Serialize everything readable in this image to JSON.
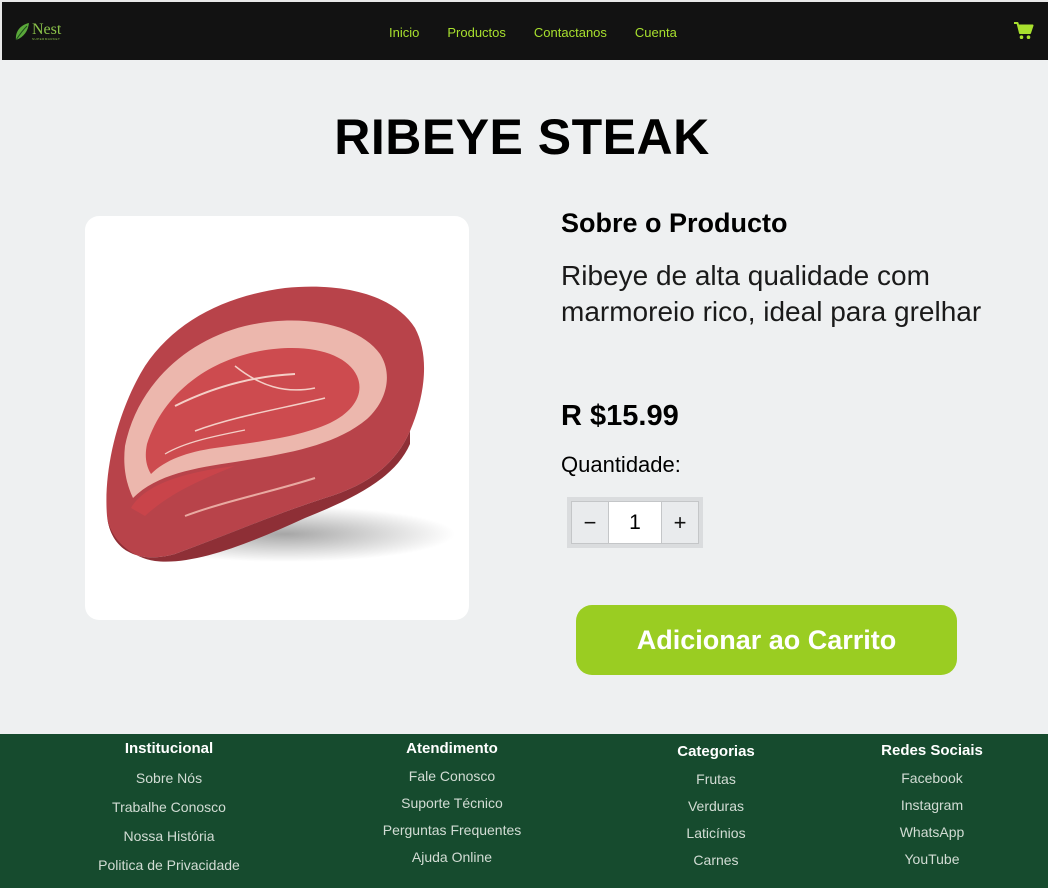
{
  "nav": {
    "logo_name": "Nest",
    "logo_sub": "SUPERMARKET",
    "links": [
      "Inicio",
      "Productos",
      "Contactanos",
      "Cuenta"
    ]
  },
  "product": {
    "title": "RIBEYE STEAK",
    "about_title": "Sobre o Producto",
    "description": "Ribeye de alta qualidade com marmoreio rico, ideal para grelhar",
    "price": "R $15.99",
    "quantity_label": "Quantidade:",
    "quantity": "1",
    "minus": "−",
    "plus": "+",
    "add_to_cart": "Adicionar ao Carrito"
  },
  "footer": {
    "columns": [
      {
        "title": "Institucional",
        "links": [
          "Sobre Nós",
          "Trabalhe Conosco",
          "Nossa História",
          "Politica de Privacidade"
        ]
      },
      {
        "title": "Atendimento",
        "links": [
          "Fale Conosco",
          "Suporte Técnico",
          "Perguntas Frequentes",
          "Ajuda Online"
        ]
      },
      {
        "title": "Categorias",
        "links": [
          "Frutas",
          "Verduras",
          "Laticínios",
          "Carnes"
        ]
      },
      {
        "title": "Redes Sociais",
        "links": [
          "Facebook",
          "Instagram",
          "WhatsApp",
          "YouTube"
        ]
      }
    ]
  },
  "colors": {
    "nav_bg": "#121212",
    "accent": "#9acd22",
    "footer_bg": "#164b2e",
    "page_bg": "#eef0f1"
  },
  "icons": [
    "leaf-logo-icon",
    "shopping-cart-icon"
  ]
}
